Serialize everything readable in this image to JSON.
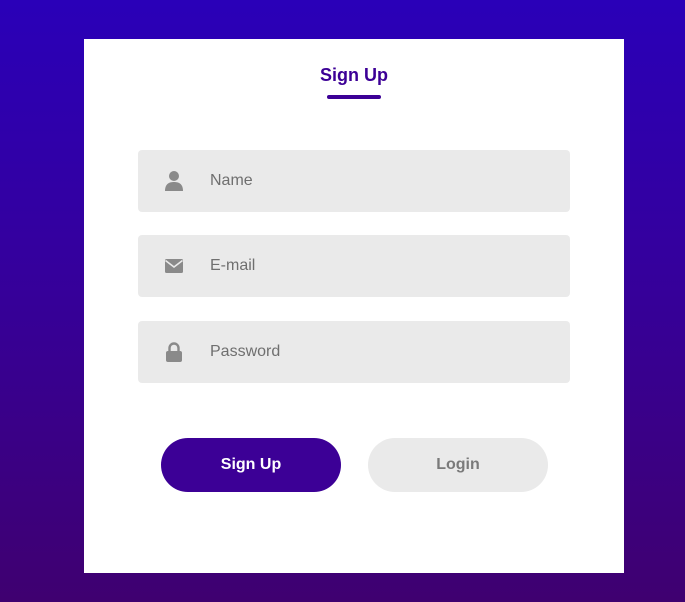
{
  "form": {
    "title": "Sign Up",
    "fields": [
      {
        "placeholder": "Name",
        "value": "",
        "icon": "user-icon"
      },
      {
        "placeholder": "E-mail",
        "value": "",
        "icon": "envelope-icon"
      },
      {
        "placeholder": "Password",
        "value": "",
        "icon": "lock-icon"
      }
    ],
    "buttons": {
      "signup_label": "Sign Up",
      "login_label": "Login"
    }
  },
  "colors": {
    "accent": "#3c0096",
    "field_bg": "#eaeaea",
    "icon": "#8a8a8a"
  }
}
